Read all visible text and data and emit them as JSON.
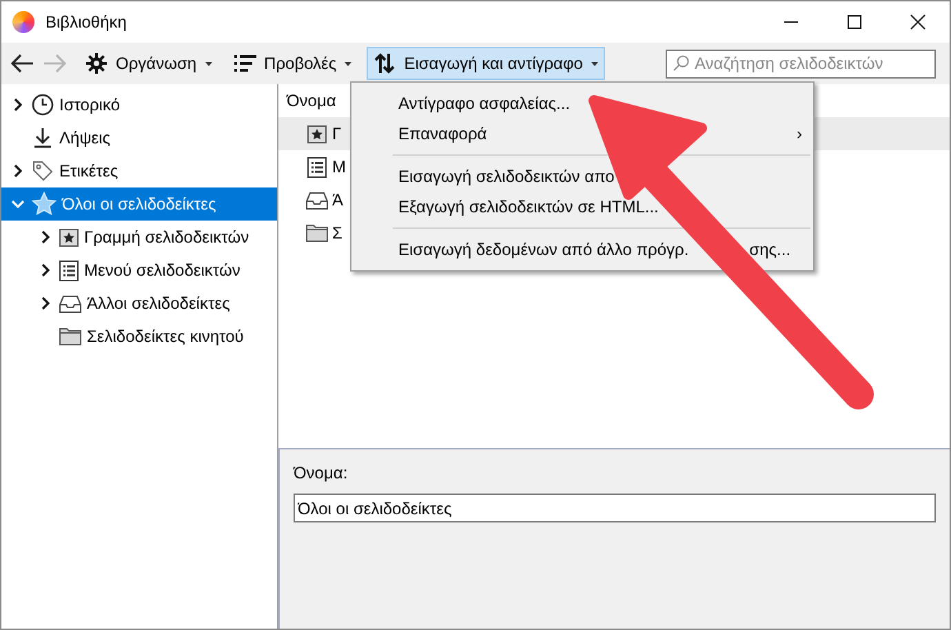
{
  "window": {
    "title": "Βιβλιοθήκη"
  },
  "toolbar": {
    "items": [
      {
        "kind": "back",
        "disabled": false
      },
      {
        "kind": "forward",
        "disabled": true
      },
      {
        "kind": "menu",
        "label": "Οργάνωση",
        "expanded": false
      },
      {
        "kind": "menu",
        "label": "Προβολές",
        "expanded": false
      },
      {
        "kind": "menu",
        "label": "Εισαγωγή και αντίγραφο",
        "expanded": true
      }
    ],
    "search": {
      "placeholder": "Αναζήτηση σελιδοδεικτών"
    }
  },
  "sidebar": {
    "items": [
      {
        "label": "Ιστορικό",
        "expanded": false,
        "has_children": true,
        "selected": false
      },
      {
        "label": "Λήψεις",
        "has_children": false,
        "selected": false
      },
      {
        "label": "Ετικέτες",
        "expanded": false,
        "has_children": true,
        "selected": false
      },
      {
        "label": "Όλοι οι σελιδοδείκτες",
        "expanded": true,
        "has_children": true,
        "selected": true,
        "children": [
          {
            "label": "Γραμμή σελιδοδεικτών",
            "expanded": false,
            "has_children": true,
            "selected": false
          },
          {
            "label": "Μενού σελιδοδεικτών",
            "expanded": false,
            "has_children": true,
            "selected": false
          },
          {
            "label": "Άλλοι σελιδοδείκτες",
            "expanded": false,
            "has_children": true,
            "selected": false
          },
          {
            "label": "Σελιδοδείκτες κινητού",
            "has_children": false,
            "selected": false
          }
        ]
      }
    ]
  },
  "list": {
    "columns": [
      "Όνομα"
    ],
    "rows": [
      {
        "label": "Γ",
        "selected": true
      },
      {
        "label": "Μ",
        "selected": false
      },
      {
        "label": "Ά",
        "selected": false
      },
      {
        "label": "Σ",
        "selected": false
      }
    ]
  },
  "menu": {
    "items": [
      {
        "kind": "item",
        "label": "Αντίγραφο ασφαλείας..."
      },
      {
        "kind": "submenu",
        "label": "Επαναφορά",
        "arrow": "›"
      },
      {
        "kind": "separator"
      },
      {
        "kind": "item",
        "label": "Εισαγωγή σελιδοδεικτών απο"
      },
      {
        "kind": "item",
        "label": "Εξαγωγή σελιδοδεικτών σε HTML..."
      },
      {
        "kind": "separator"
      },
      {
        "kind": "item",
        "label": "Εισαγωγή δεδομένων από άλλο πρόγρ.",
        "label_tail": "σης..."
      }
    ]
  },
  "details": {
    "label": "Όνομα:",
    "value": "Όλοι οι σελιδοδείκτες"
  },
  "annotation": {
    "kind": "arrow"
  }
}
